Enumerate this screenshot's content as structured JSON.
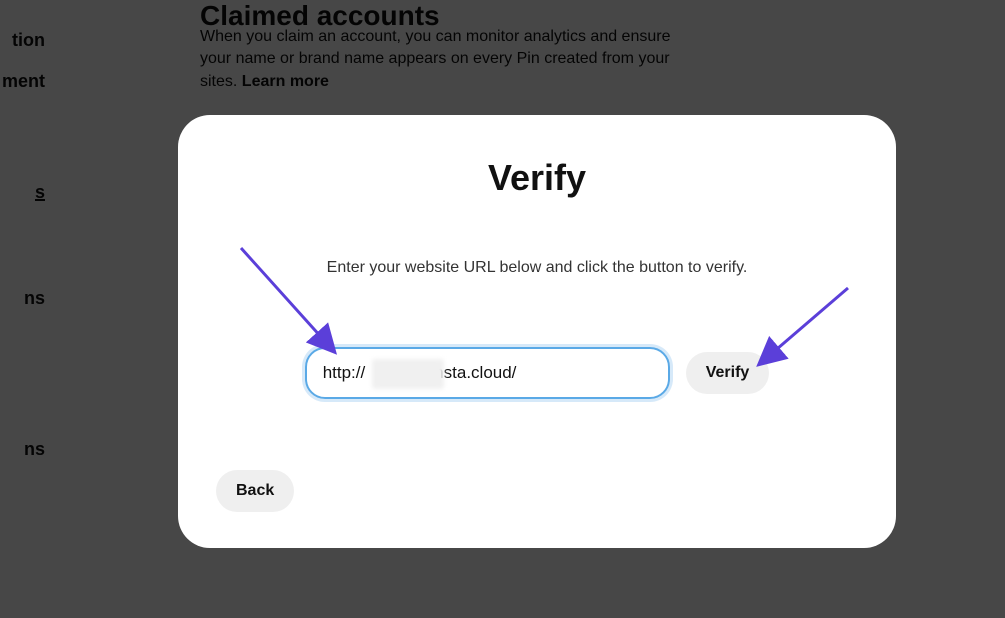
{
  "sidebar": {
    "items": [
      "tion",
      "ment",
      "s",
      "ns",
      "ns"
    ]
  },
  "section": {
    "title": "Claimed accounts",
    "description_line1": "When you claim an account, you can monitor analytics and ensure",
    "description_line2": "your name or brand name appears on every Pin created from your",
    "description_line3": "sites. ",
    "learn_more": "Learn more"
  },
  "modal": {
    "title": "Verify",
    "description": "Enter your website URL below and click the button to verify.",
    "input_value": "http://           .kinsta.cloud/",
    "verify_label": "Verify",
    "back_label": "Back"
  }
}
